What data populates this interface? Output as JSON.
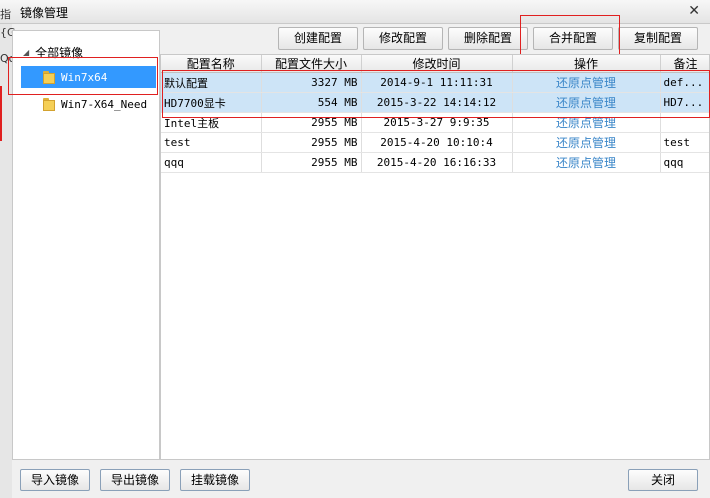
{
  "window": {
    "title": "镜像管理",
    "close_label": "✕"
  },
  "left_edge_fragments": [
    "指",
    "{G",
    "Qc"
  ],
  "tree": {
    "root": "全部镜像",
    "items": [
      {
        "label": "Win7x64",
        "selected": true
      },
      {
        "label": "Win7-X64_Need",
        "selected": false
      }
    ]
  },
  "toolbar": {
    "create": "创建配置",
    "modify": "修改配置",
    "delete": "删除配置",
    "merge": "合并配置",
    "copy": "复制配置"
  },
  "table": {
    "columns": [
      "配置名称",
      "配置文件大小",
      "修改时间",
      "操作",
      "备注"
    ],
    "rows": [
      {
        "name": "默认配置",
        "size": "3327 MB",
        "time": "2014-9-1 11:11:31",
        "action": "还原点管理",
        "note": "def...",
        "selected": true
      },
      {
        "name": "HD7700显卡",
        "size": "554 MB",
        "time": "2015-3-22 14:14:12",
        "action": "还原点管理",
        "note": "HD7...",
        "selected": true
      },
      {
        "name": "Intel主板",
        "size": "2955 MB",
        "time": "2015-3-27 9:9:35",
        "action": "还原点管理",
        "note": "",
        "selected": false
      },
      {
        "name": "test",
        "size": "2955 MB",
        "time": "2015-4-20 10:10:4",
        "action": "还原点管理",
        "note": "test",
        "selected": false
      },
      {
        "name": "qqq",
        "size": "2955 MB",
        "time": "2015-4-20 16:16:33",
        "action": "还原点管理",
        "note": "qqq",
        "selected": false
      }
    ]
  },
  "bottom": {
    "import": "导入镜像",
    "export": "导出镜像",
    "mount": "挂载镜像",
    "close": "关闭"
  },
  "colors": {
    "selection_blue": "#3399ff",
    "row_selection": "#cde4f7",
    "link": "#3a86c8",
    "highlight_red": "#e02020"
  }
}
